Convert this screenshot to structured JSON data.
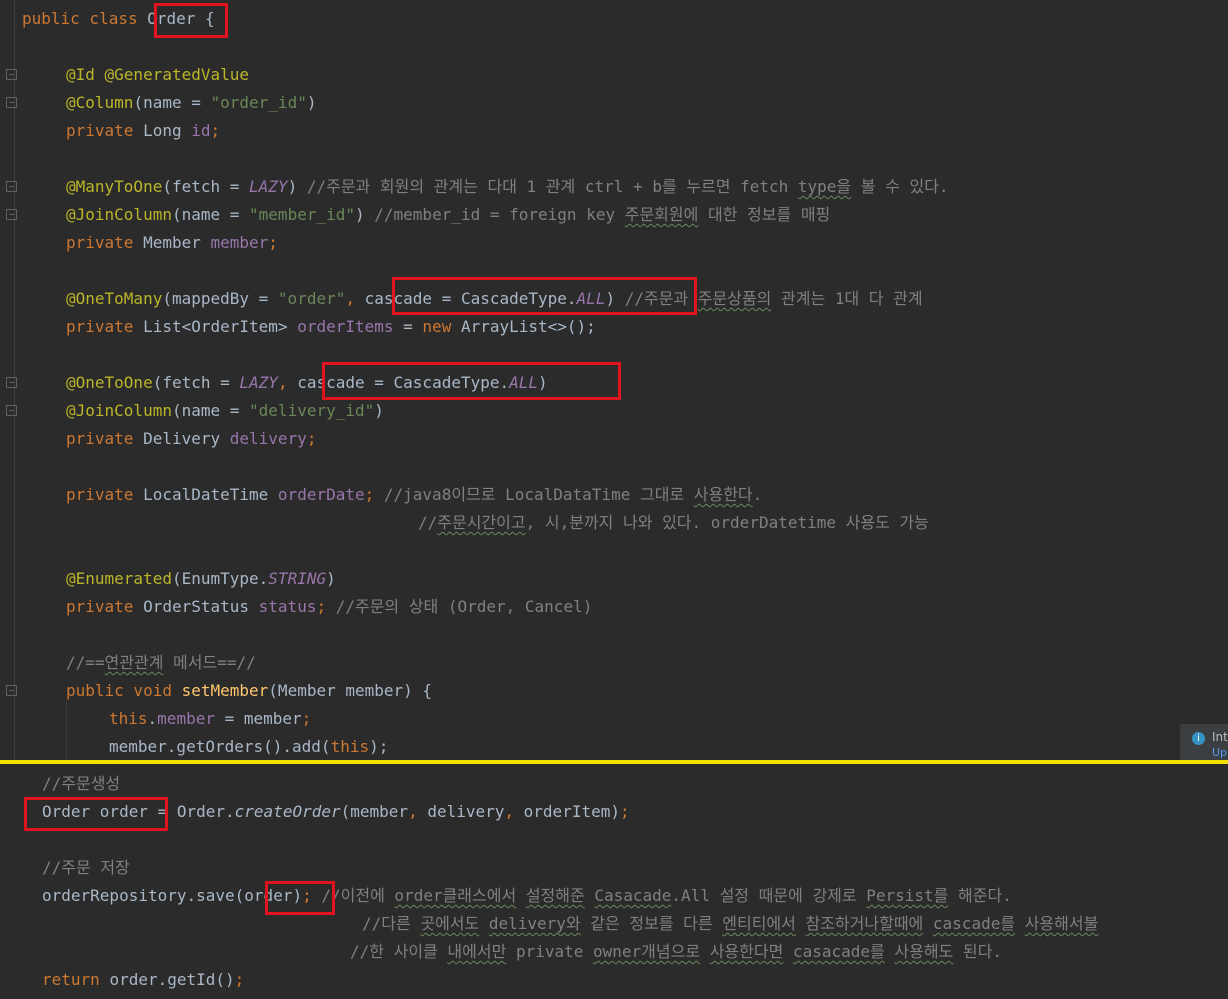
{
  "top_editor": {
    "lines": {
      "l1": {
        "kw": "public class ",
        "name": "Order",
        "rest": " {"
      },
      "l2": {
        "an": "@Id @GeneratedValue"
      },
      "l3": {
        "an": "@Column",
        "p1": "(name = ",
        "str": "\"order_id\"",
        "p2": ")"
      },
      "l4": {
        "kw": "private ",
        "type": "Long ",
        "fld": "id",
        "semi": ";"
      },
      "l5": {
        "an": "@ManyToOne",
        "p1": "(fetch = ",
        "it": "LAZY",
        "p2": ") ",
        "cm1": "//주문과 회원의 관계는 다대 1 관계 ctrl + b를 누르면 fetch ",
        "sq": "type을",
        "cm2": " 볼 수 있다."
      },
      "l6": {
        "an": "@JoinColumn",
        "p1": "(name = ",
        "str": "\"member_id\"",
        "p2": ") ",
        "cm1": "//member_id = foreign key ",
        "sq": "주문회원에",
        "cm2": " 대한 정보를 매핑"
      },
      "l7": {
        "kw": "private ",
        "type": "Member ",
        "fld": "member",
        "semi": ";"
      },
      "l8": {
        "an": "@OneToMany",
        "p1": "(mappedBy = ",
        "str": "\"order\"",
        "comma": ", ",
        "p2": "cascade = CascadeType.",
        "it": "ALL",
        "p3": ") ",
        "cm1": "//주문과 ",
        "sq": "주문상품의",
        "cm2": " 관계는 1대 다 관계"
      },
      "l9": {
        "kw": "private ",
        "type": "List<OrderItem> ",
        "fld": "orderItems",
        "eq": " = ",
        "kw2": "new ",
        "rest": "ArrayList<>();"
      },
      "l10": {
        "an": "@OneToOne",
        "p1": "(fetch = ",
        "it": "LAZY",
        "comma": ", ",
        "p2": "cascade = CascadeType.",
        "it2": "ALL",
        "p3": ")"
      },
      "l11": {
        "an": "@JoinColumn",
        "p1": "(name = ",
        "str": "\"delivery_id\"",
        "p2": ")"
      },
      "l12": {
        "kw": "private ",
        "type": "Delivery ",
        "fld": "delivery",
        "semi": ";"
      },
      "l13": {
        "kw": "private ",
        "type": "LocalDateTime ",
        "fld": "orderDate",
        "semi": "; ",
        "cm1": "//java8이므로 LocalDataTime 그대로 ",
        "sq": "사용한다",
        "cm2": "."
      },
      "l14": {
        "cm0": "//",
        "sq": "주문시간이고",
        "cm1": ", 시,분까지 나와 있다. orderDatetime 사용도 가능"
      },
      "l15": {
        "an": "@Enumerated",
        "p1": "(EnumType.",
        "it": "STRING",
        "p2": ")"
      },
      "l16": {
        "kw": "private ",
        "type": "OrderStatus ",
        "fld": "status",
        "semi": "; ",
        "cm": "//주문의 상태 (Order, Cancel)"
      },
      "l17": {
        "cm0": "//==",
        "sq": "연관관계",
        "cm1": " 메서드==//"
      },
      "l18": {
        "kw": "public void ",
        "mth": "setMember",
        "rest": "(Member member) {"
      },
      "l19": {
        "kw": "this",
        "dot": ".",
        "fld": "member",
        "rest": " = member",
        "semi": ";"
      },
      "l20": {
        "a": "member.getOrders().add(",
        "kw": "this",
        "b": ");"
      }
    }
  },
  "bottom_editor": {
    "lines": {
      "b1": {
        "cm": "//주문생성"
      },
      "b2": {
        "a": "Order order = Order.",
        "it": "createOrder",
        "b": "(member",
        "c1": ", ",
        "b2": "delivery",
        "c2": ", ",
        "b3": "orderItem)",
        "semi": ";"
      },
      "b3": {
        "cm": "//주문 저장"
      },
      "b4": {
        "a": "orderRepository.save(order)",
        "semi": "; ",
        "cm1": "//이전에 ",
        "sq1": "order클래스에서",
        "cm2": " ",
        "sq2": "설정해준",
        "cm3": " ",
        "sq3": "Casacade",
        "cm4": ".All 설정 때문에 강제로 ",
        "sq4": "Persist를",
        "cm5": " 해준다."
      },
      "b5": {
        "cm1": "//다른 ",
        "sq1": "곳에서도",
        "cm2": " ",
        "sq2": "delivery와",
        "cm3": " 같은 정보를 다른 ",
        "sq3": "엔티티에서",
        "cm4": " ",
        "sq4": "참조하거나할때에",
        "cm5": " ",
        "sq5": "cascade를",
        "cm6": " ",
        "sq6": "사용해서불"
      },
      "b6": {
        "cm1": "//한 사이클 ",
        "sq1": "내에서만",
        "cm2": " private ",
        "sq2": "owner개념으로",
        "cm3": " ",
        "sq3": "사용한다면",
        "cm4": " ",
        "sq4": "casacade를",
        "cm5": " ",
        "sq5": "사용해도",
        "cm6": " 된다."
      },
      "b7": {
        "kw": "return ",
        "rest": "order.getId()",
        "semi": ";"
      }
    }
  },
  "notification": {
    "title": "Int",
    "link": "Up"
  },
  "colors": {
    "background": "#2b2b2b",
    "keyword": "#cc7832",
    "annotation": "#bbb529",
    "string": "#6a8759",
    "field": "#9876aa",
    "comment": "#808080",
    "highlight_box": "#e0141f",
    "divider": "#f2e100"
  }
}
